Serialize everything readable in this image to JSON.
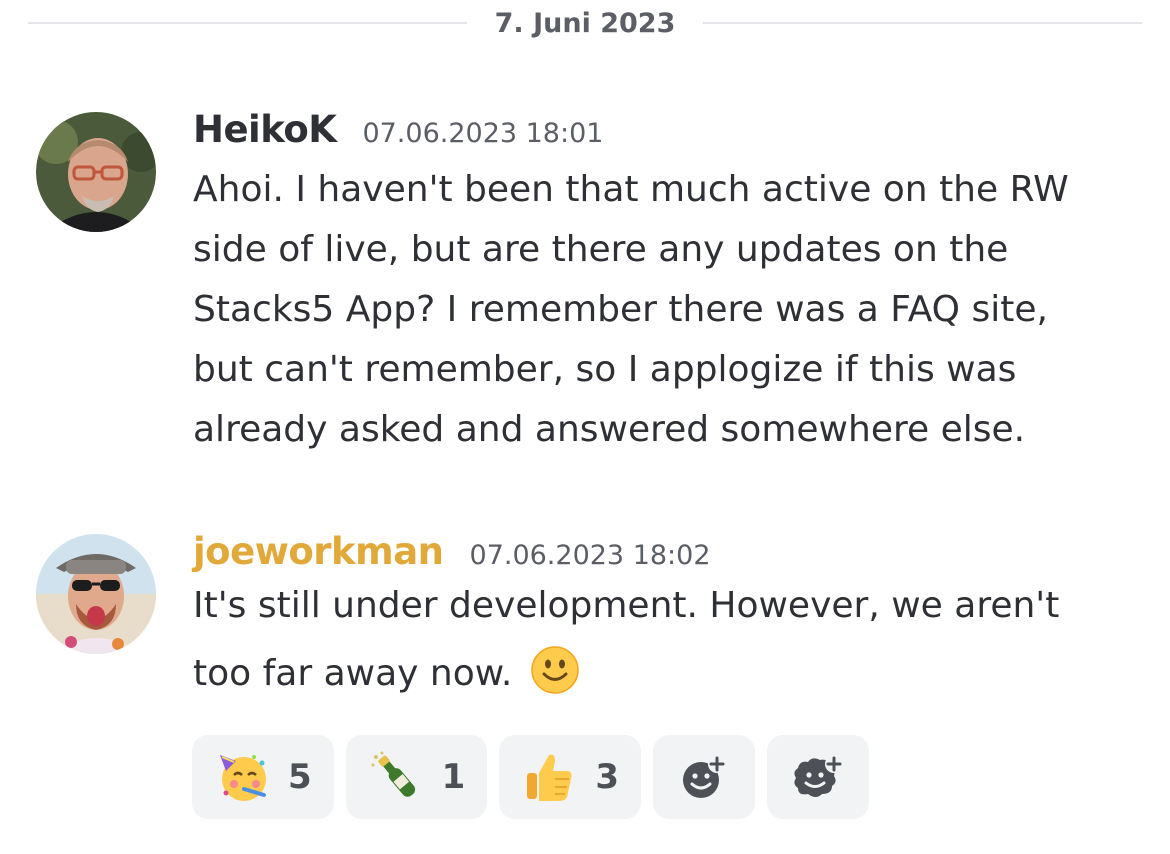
{
  "date_divider": "7. Juni 2023",
  "messages": [
    {
      "author": "HeikoK",
      "timestamp": "07.06.2023 18:01",
      "lines": [
        "Ahoi. I haven't been that much active on the RW",
        "side of live, but are there any updates on the",
        "Stacks5 App? I remember there was a FAQ site,",
        "but can't remember, so I applogize if this was",
        "already asked and answered somewhere else."
      ]
    },
    {
      "author": "joeworkman",
      "author_color": "#e0a93a",
      "timestamp": "07.06.2023 18:02",
      "lines": [
        "It's still under development. However, we aren't",
        "too far away now."
      ],
      "inline_emoji": "slightly-smiling-face"
    }
  ],
  "reactions": [
    {
      "emoji": "partying-face",
      "count": "5"
    },
    {
      "emoji": "champagne-bottle",
      "count": "1"
    },
    {
      "emoji": "thumbs-up",
      "count": "3"
    }
  ],
  "add_reaction_buttons": [
    "add-reaction",
    "add-super-reaction"
  ]
}
